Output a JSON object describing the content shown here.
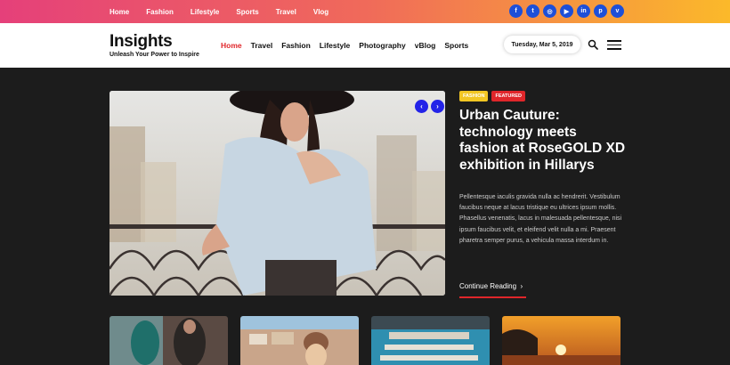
{
  "topbar": {
    "nav": [
      "Home",
      "Fashion",
      "Lifestyle",
      "Sports",
      "Travel",
      "Vlog"
    ],
    "socials": [
      {
        "icon": "facebook-icon",
        "glyph": "f"
      },
      {
        "icon": "twitter-icon",
        "glyph": "t"
      },
      {
        "icon": "instagram-icon",
        "glyph": "◎"
      },
      {
        "icon": "youtube-icon",
        "glyph": "▶"
      },
      {
        "icon": "linkedin-icon",
        "glyph": "in"
      },
      {
        "icon": "pinterest-icon",
        "glyph": "p"
      },
      {
        "icon": "vimeo-icon",
        "glyph": "v"
      }
    ]
  },
  "header": {
    "logo": "Insights",
    "tagline": "Unleash Your Power to Inspire",
    "nav": [
      "Home",
      "Travel",
      "Fashion",
      "Lifestyle",
      "Photography",
      "vBlog",
      "Sports"
    ],
    "active_nav": "Home",
    "date": "Tuesday, Mar 5, 2019"
  },
  "hero": {
    "badges": [
      "Fashion",
      "Featured"
    ],
    "title": "Urban Cauture: technology meets fashion at RoseGOLD XD exhibition in Hillarys",
    "excerpt": "Pellentesque iaculis gravida nulla ac hendrerit. Vestibulum faucibus neque at lacus tristique eu ultrices ipsum mollis. Phasellus venenatis, lacus in malesuada pellentesque, nisi ipsum faucibus velit, et eleifend velit nulla a mi. Praesent pharetra semper purus, a vehicula massa interdum in.",
    "read_more": "Continue Reading"
  },
  "colors": {
    "accent": "#e0262a",
    "social_bg": "#1d4fd8",
    "slider_arrow": "#2323e8",
    "badge_fashion": "#f2c623"
  }
}
